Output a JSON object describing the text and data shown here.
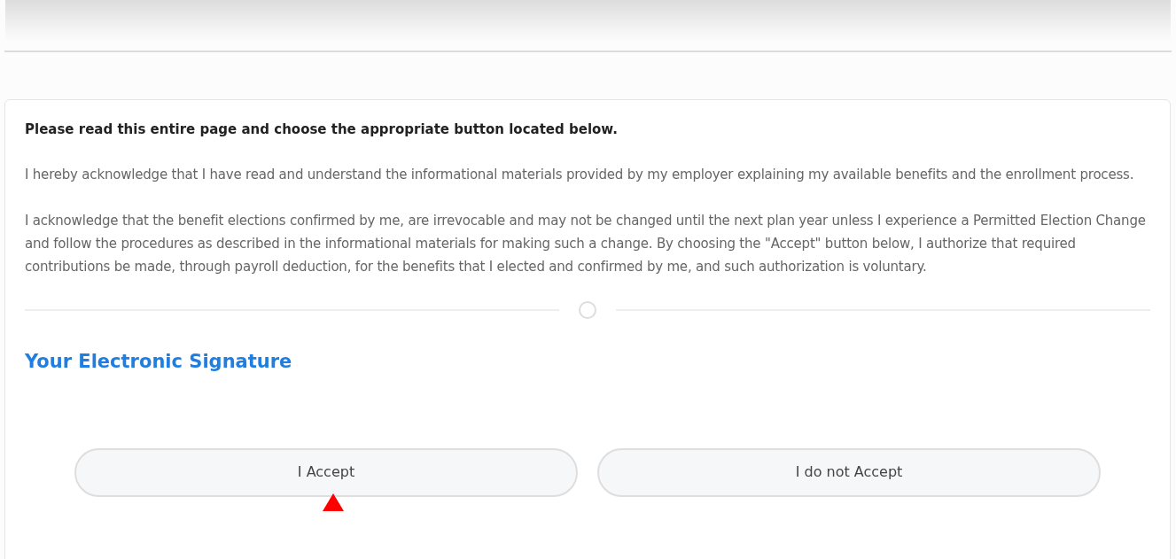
{
  "notice": {
    "heading": "Please read this entire page and choose the appropriate button located below.",
    "paragraphs": [
      "I hereby acknowledge that I have read and understand the informational materials provided by my employer explaining my available benefits and the enrollment process.",
      "I acknowledge that the benefit elections confirmed by me, are irrevocable and may not be changed until the next plan year unless I experience a Permitted Election Change and follow the procedures as described in the informational materials for making such a change. By choosing the \"Accept\" button below, I authorize that required contributions be made, through payroll deduction, for the benefits that I elected and confirmed by me, and such authorization is voluntary."
    ]
  },
  "signature": {
    "title": "Your Electronic Signature",
    "buttons": [
      {
        "label": "I Accept"
      },
      {
        "label": "I do not Accept"
      }
    ]
  }
}
